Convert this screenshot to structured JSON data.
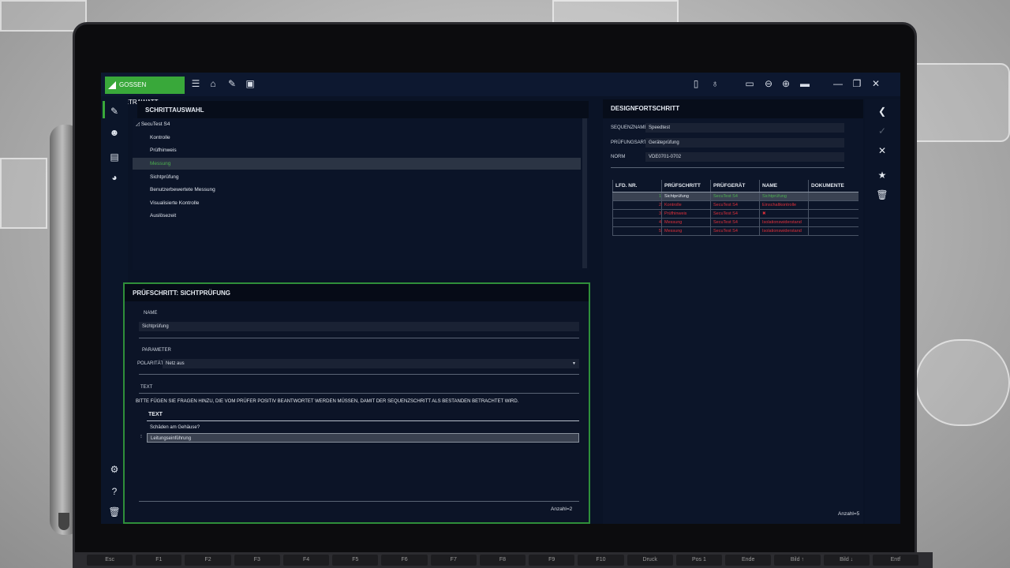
{
  "app": {
    "brand": "GOSSEN METRAWATT",
    "toolbar_left_icons": [
      "menu-icon",
      "home-icon",
      "plug-icon",
      "edit-icon"
    ],
    "toolbar_right_icons": [
      "panel-icon",
      "bulb-icon",
      "screen-icon",
      "zoom-out-icon",
      "zoom-in-icon",
      "layout-icon",
      "minimize-icon",
      "restore-icon",
      "close-icon"
    ]
  },
  "leftnav": {
    "icons": [
      "plug-icon",
      "face-icon",
      "clipboard-icon",
      "chart-icon",
      "settings-icon",
      "help-icon",
      "trash-icon"
    ]
  },
  "step_selection": {
    "title": "SCHRITTAUSWAHL",
    "root": "SecuTest S4",
    "items": [
      "Kontrolle",
      "Prüfhinweis",
      "Messung",
      "Sichtprüfung",
      "Benutzerbewertete Messung",
      "Visualisierte Kontrolle",
      "Auslösezeit"
    ],
    "selected": "Messung"
  },
  "step_detail": {
    "title": "PRÜFSCHRITT: SICHTPRÜFUNG",
    "name_label": "NAME",
    "name_value": "Sichtprüfung",
    "param_label": "PARAMETER",
    "polarity_label": "POLARITÄT",
    "polarity_value": "Netz aus",
    "text_label": "TEXT",
    "instruction": "BITTE FÜGEN SIE FRAGEN HINZU, DIE VOM PRÜFER POSITIV BEANTWORTET WERDEN MÜSSEN, DAMIT DER SEQUENZSCHRITT ALS BESTANDEN BETRACHTET WIRD.",
    "col_text": "TEXT",
    "questions": [
      "Schäden am Gehäuse?",
      "Leitungseinführung"
    ],
    "count": "Anzahl=2"
  },
  "design_progress": {
    "title": "DESIGNFORTSCHRITT",
    "seq_label": "SEQUENZNAME",
    "seq_value": "Speedtest",
    "type_label": "PRÜFUNGSART",
    "type_value": "Geräteprüfung",
    "norm_label": "NORM",
    "norm_value": "VDE0701-0702",
    "columns": [
      "LFD. NR.",
      "PRÜFSCHRITT",
      "PRÜFGERÄT",
      "NAME",
      "DOKUMENTE"
    ],
    "rows": [
      {
        "nr": "1",
        "step": "Sichtprüfung",
        "device": "SecuTest S4",
        "name": "Sichtprüfung",
        "doc": "",
        "status": "ok"
      },
      {
        "nr": "2",
        "step": "Kontrolle",
        "device": "SecuTest S4",
        "name": "Einschaltkontrolle",
        "doc": "",
        "status": "err"
      },
      {
        "nr": "3",
        "step": "Prüfhinweis",
        "device": "SecuTest S4",
        "name": "",
        "doc": "",
        "status": "err"
      },
      {
        "nr": "4",
        "step": "Messung",
        "device": "SecuTest S4",
        "name": "Isolationswiderstand",
        "doc": "",
        "status": "err"
      },
      {
        "nr": "5",
        "step": "Messung",
        "device": "SecuTest S4",
        "name": "Isolationswiderstand",
        "doc": "",
        "status": "err"
      }
    ],
    "count": "Anzahl=5"
  },
  "colors": {
    "accent": "#39a83a",
    "ok": "#4caf50",
    "error": "#e0303a"
  },
  "keyboard": [
    "Esc",
    "F1",
    "F2",
    "F3",
    "F4",
    "F5",
    "F6",
    "F7",
    "F8",
    "F9",
    "F10",
    "Druck",
    "Pos 1",
    "Ende",
    "Bild ↑",
    "Bild ↓",
    "Entf"
  ]
}
